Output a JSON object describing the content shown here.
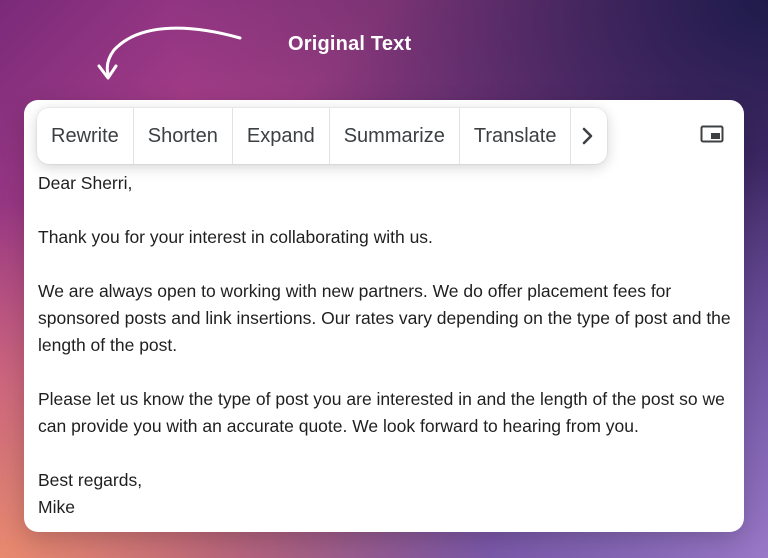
{
  "overlay_label": "Original Text",
  "toolbar": {
    "buttons": [
      "Rewrite",
      "Shorten",
      "Expand",
      "Summarize",
      "Translate"
    ],
    "more_icon": "chevron-right-icon"
  },
  "window_icon": "picture-in-picture-icon",
  "email": {
    "greeting": "Dear Sherri,",
    "paragraph_1": "Thank you for your interest in collaborating with us.",
    "paragraph_2": "We are always open to working with new partners. We do offer placement fees for sponsored posts and link insertions. Our rates vary depending on the type of post and the length of the post.",
    "paragraph_3": "Please let us know the type of post you are interested in and the length of the post so we can provide you with an accurate quote. We look forward to hearing from you.",
    "closing": "Best regards,",
    "signature": "Mike"
  }
}
